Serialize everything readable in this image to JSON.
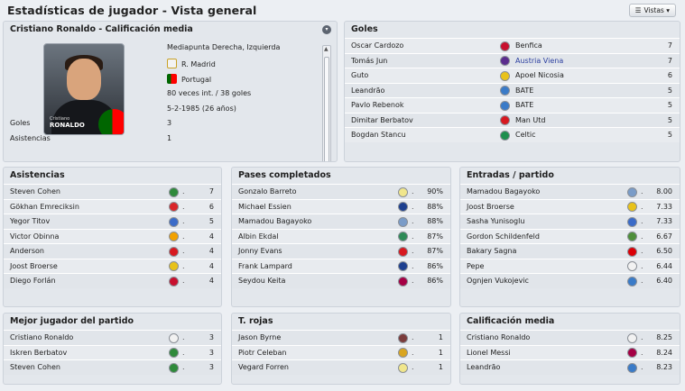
{
  "header": {
    "title": "Estadísticas de jugador - Vista general",
    "views_button": "Vistas"
  },
  "player": {
    "title": "Cristiano Ronaldo - Calificación media",
    "card_caption_small": "Cristiano",
    "card_caption": "RONALDO",
    "position": "Mediapunta Derecha, Izquierda",
    "club": "R. Madrid",
    "nation": "Portugal",
    "caps": "80 veces int. / 38 goles",
    "dob": "5-2-1985 (26 años)",
    "stats": [
      {
        "label": "Goles",
        "value": "3"
      },
      {
        "label": "Asistencias",
        "value": "1"
      }
    ]
  },
  "goles": {
    "title": "Goles",
    "rows": [
      {
        "name": "Oscar Cardozo",
        "club": "Benfica",
        "value": "7",
        "color": "#c8102e"
      },
      {
        "name": "Tomás Jun",
        "club": "Austria Viena",
        "value": "7",
        "color": "#5b2d8e",
        "link": true
      },
      {
        "name": "Guto",
        "club": "Apoel Nicosia",
        "value": "6",
        "color": "#e8c21a"
      },
      {
        "name": "Leandrão",
        "club": "BATE",
        "value": "5",
        "color": "#3a7bc8"
      },
      {
        "name": "Pavlo Rebenok",
        "club": "BATE",
        "value": "5",
        "color": "#3a7bc8"
      },
      {
        "name": "Dimitar Berbatov",
        "club": "Man Utd",
        "value": "5",
        "color": "#d71920"
      },
      {
        "name": "Bogdan Stancu",
        "club": "Celtic",
        "value": "5",
        "color": "#1e8f4e"
      }
    ]
  },
  "panels": [
    {
      "title": "Asistencias",
      "rows": [
        {
          "name": "Steven Cohen",
          "value": "7",
          "color": "#2f8a3b"
        },
        {
          "name": "Gökhan Emreciksin",
          "value": "6",
          "color": "#d9252a"
        },
        {
          "name": "Yegor Titov",
          "value": "5",
          "color": "#3a6bc8"
        },
        {
          "name": "Victor Obinna",
          "value": "4",
          "color": "#f2a100"
        },
        {
          "name": "Anderson",
          "value": "4",
          "color": "#d71920"
        },
        {
          "name": "Joost Broerse",
          "value": "4",
          "color": "#e8c21a"
        },
        {
          "name": "Diego Forlán",
          "value": "4",
          "color": "#c8102e"
        }
      ]
    },
    {
      "title": "Pases completados",
      "rows": [
        {
          "name": "Gonzalo Barreto",
          "value": "90%",
          "color": "#f0e68c"
        },
        {
          "name": "Michael Essien",
          "value": "88%",
          "color": "#1d3f8f"
        },
        {
          "name": "Mamadou Bagayoko",
          "value": "88%",
          "color": "#7a9cc8"
        },
        {
          "name": "Albin Ekdal",
          "value": "87%",
          "color": "#2e8b57"
        },
        {
          "name": "Jonny Evans",
          "value": "87%",
          "color": "#d71920"
        },
        {
          "name": "Frank Lampard",
          "value": "86%",
          "color": "#1d3f8f"
        },
        {
          "name": "Seydou Keita",
          "value": "86%",
          "color": "#a50044"
        }
      ]
    },
    {
      "title": "Entradas / partido",
      "rows": [
        {
          "name": "Mamadou Bagayoko",
          "value": "8.00",
          "color": "#7a9cc8"
        },
        {
          "name": "Joost Broerse",
          "value": "7.33",
          "color": "#e8c21a"
        },
        {
          "name": "Sasha Yunisoglu",
          "value": "7.33",
          "color": "#3a6bc8"
        },
        {
          "name": "Gordon Schildenfeld",
          "value": "6.67",
          "color": "#4e8f3a"
        },
        {
          "name": "Bakary Sagna",
          "value": "6.50",
          "color": "#db0007"
        },
        {
          "name": "Pepe",
          "value": "6.44",
          "color": "#f2f2f2"
        },
        {
          "name": "Ognjen Vukojevic",
          "value": "6.40",
          "color": "#3a7bc8"
        }
      ]
    },
    {
      "title": "Mejor jugador del partido",
      "rows": [
        {
          "name": "Cristiano Ronaldo",
          "value": "3",
          "color": "#f2f2f2"
        },
        {
          "name": "Iskren Berbatov",
          "value": "3",
          "color": "#2f8a3b"
        },
        {
          "name": "Steven Cohen",
          "value": "3",
          "color": "#2f8a3b"
        }
      ]
    },
    {
      "title": "T. rojas",
      "rows": [
        {
          "name": "Jason Byrne",
          "value": "1",
          "color": "#7a3b3b"
        },
        {
          "name": "Piotr Celeban",
          "value": "1",
          "color": "#d9a520"
        },
        {
          "name": "Vegard Forren",
          "value": "1",
          "color": "#f0e68c"
        }
      ]
    },
    {
      "title": "Calificación media",
      "rows": [
        {
          "name": "Cristiano Ronaldo",
          "value": "8.25",
          "color": "#f2f2f2"
        },
        {
          "name": "Lionel Messi",
          "value": "8.24",
          "color": "#a50044"
        },
        {
          "name": "Leandrão",
          "value": "8.23",
          "color": "#3a7bc8"
        }
      ]
    }
  ]
}
